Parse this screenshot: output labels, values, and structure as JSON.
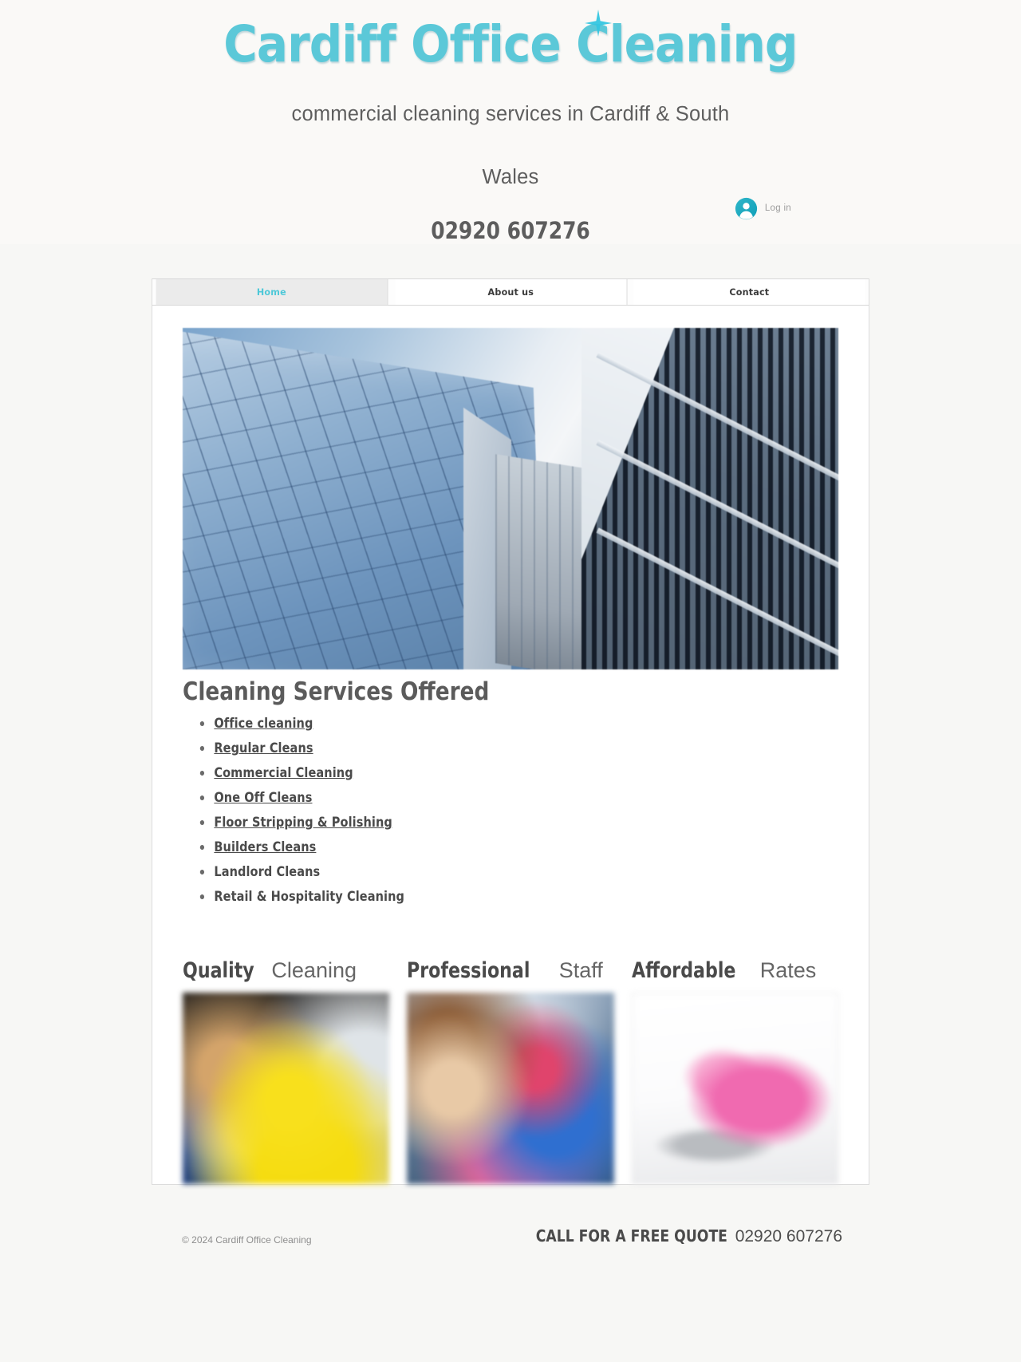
{
  "header": {
    "logo_text": "Cardiff Office Cleaning",
    "logo_color": "#5bc8d8",
    "star_icon": "sparkle-star-icon",
    "tagline_line1": "commercial cleaning services in Cardiff & South",
    "tagline_line2": "Wales",
    "phone": "02920 607276"
  },
  "login": {
    "avatar_icon": "user-avatar-icon",
    "label": "Log in"
  },
  "nav": {
    "items": [
      {
        "label": "Home",
        "active": true
      },
      {
        "label": "About us",
        "active": false
      },
      {
        "label": "Contact",
        "active": false
      }
    ],
    "active_color": "#4ec8d8"
  },
  "hero": {
    "alt": "glass office skyscraper looking up at sky"
  },
  "services": {
    "title": "Cleaning Services Offered",
    "items": [
      {
        "label": "Office cleaning",
        "link": true
      },
      {
        "label": "Regular Cleans",
        "link": true
      },
      {
        "label": "Commercial Cleaning",
        "link": true
      },
      {
        "label": "One Off Cleans",
        "link": true
      },
      {
        "label": "Floor Stripping & Polishing",
        "link": true
      },
      {
        "label": "Builders Cleans",
        "link": true
      },
      {
        "label": "Landlord Cleans",
        "link": false
      },
      {
        "label": "Retail & Hospitality Cleaning",
        "link": false
      }
    ]
  },
  "features": [
    {
      "strong": "Quality",
      "light": "Cleaning",
      "image_alt": "cleaner with yellow cloth"
    },
    {
      "strong": "Professional",
      "light": "Staff",
      "image_alt": "cleaning staff with supplies"
    },
    {
      "strong": "Affordable",
      "light": "Rates",
      "image_alt": "pink piggy bank on calculator"
    }
  ],
  "footer": {
    "copyright": "© 2024 Cardiff Office Cleaning",
    "cta_label": "CALL FOR A FREE QUOTE",
    "cta_phone": "02920 607276"
  }
}
